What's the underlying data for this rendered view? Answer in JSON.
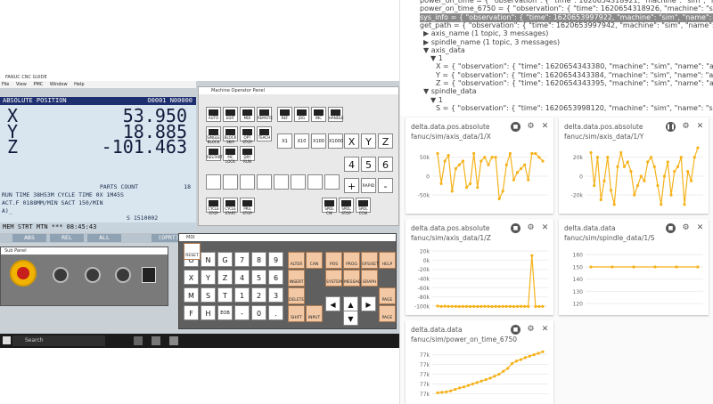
{
  "cnc": {
    "window_title": "FANUC CNC GUIDE",
    "menu": [
      "File",
      "View",
      "PMC",
      "Window",
      "Help"
    ],
    "screen_header": "ABSOLUTE POSITION",
    "program_no": "O0001 N00000",
    "axes": [
      {
        "label": "X",
        "value": "53.950"
      },
      {
        "label": "Y",
        "value": "18.885"
      },
      {
        "label": "Z",
        "value": "-101.463"
      }
    ],
    "parts_count_label": "PARTS COUNT",
    "parts_count": "18",
    "run_time": "RUN TIME     38H53M CYCLE TIME    0X 1M45S",
    "act_f": "ACT.F     0188MM/MIN SACT      150/MIN",
    "prompt": "A)_",
    "s_value": "S 1510002",
    "status": "MEM  STRT MTN ***    08:45:43",
    "softkeys": [
      "ABS",
      "REL",
      "ALL",
      "(OPRT)"
    ],
    "operator_panel_title": "Sub Panel",
    "machine_panel_title": "Machine Operator Panel",
    "mdi_title": "MDI"
  },
  "machine_keys": [
    "AUTO",
    "EDIT",
    "MDI",
    "REMOTE",
    "REF",
    "JOG",
    "INC",
    "HANDLE",
    "SINGLE BLOCK",
    "BLOCK SKIP",
    "OPT STOP",
    "TEACH",
    "RESTART",
    "MC LOCK",
    "DRY RUN",
    "CYCLE STOP",
    "CYCLE START",
    "PRG STOP",
    "SPDL CW",
    "SPDL STOP",
    "SPDL CCW"
  ],
  "jog_keys": [
    "X1",
    "X10",
    "X100",
    "X1000"
  ],
  "axis_keys": [
    "X",
    "Y",
    "Z",
    "4",
    "5",
    "6",
    "+",
    "RAPID",
    "-"
  ],
  "mdi_keys": [
    "O",
    "N",
    "G",
    "7",
    "8",
    "9",
    "X",
    "Y",
    "Z",
    "4",
    "5",
    "6",
    "M",
    "S",
    "T",
    "1",
    "2",
    "3",
    "F",
    "H",
    "EOB",
    "-",
    "0",
    "."
  ],
  "mdi_func_keys": [
    "ALTER",
    "CAN",
    "POS",
    "PROG",
    "OFS/SET",
    "HELP",
    "INSERT",
    "INPUT",
    "SYSTEM",
    "MESSAGE",
    "GRAPH",
    "DELETE",
    "SHIFT",
    "RESET",
    "PAGE",
    "PAGE"
  ],
  "taskbar": {
    "search_placeholder": "Search"
  },
  "tree": {
    "lines": [
      "power_on_time = { \"observation\": { \"time\": 1620654318921, \"machine\": \"sim\", \"name\": \"power_on",
      "power_on_time_6750 = { \"observation\": { \"time\": 1620654318926, \"machine\": \"sim\", \"name\": \"power",
      "sys_info = { \"observation\": { \"time\": 1620653997922, \"machine\": \"sim\", \"name\": \"sys_info\", \"marker\":",
      "get_path = { \"observation\": { \"time\": 1620653997942, \"machine\": \"sim\", \"name\": \"get_path\", \"marker\": {",
      "▶ axis_name (1 topic, 3 messages)",
      "▶ spindle_name (1 topic, 3 messages)",
      "▼ axis_data",
      "▼ 1",
      "X = { \"observation\": { \"time\": 1620654343380, \"machine\": \"sim\", \"name\": \"axis_data\", \"marker\": [{",
      "Y = { \"observation\": { \"time\": 1620654343384, \"machine\": \"sim\", \"name\": \"axis_data\", \"marker\": [{",
      "Z = { \"observation\": { \"time\": 1620654343395, \"machine\": \"sim\", \"name\": \"axis_data\", \"marker\": [{",
      "▼ spindle_data",
      "▼ 1",
      "S = { \"observation\": { \"time\": 1620653998120, \"machine\": \"sim\", \"name\": \"spindle_data\", \"marker\": [{"
    ]
  },
  "cards": [
    {
      "title": "delta.data.pos.absolute",
      "topic": "fanuc/sim/axis_data/1/X"
    },
    {
      "title": "delta.data.pos.absolute",
      "topic": "fanuc/sim/axis_data/1/Y"
    },
    {
      "title": "delta.data.pos.absolute",
      "topic": "fanuc/sim/axis_data/1/Z"
    },
    {
      "title": "delta.data.data",
      "topic": "fanuc/sim/spindle_data/1/S"
    },
    {
      "title": "delta.data.data",
      "topic": "fanuc/sim/power_on_time_6750"
    }
  ],
  "colors": {
    "series": "#f5b21a",
    "accent": "#1d2f6e"
  },
  "chart_data": [
    {
      "type": "line",
      "ylabels": [
        "50k",
        "0",
        "-50k"
      ],
      "yticks": [
        50000,
        0,
        -50000
      ],
      "ylim": [
        -85000,
        80000
      ],
      "values": [
        60000,
        -20000,
        40000,
        55000,
        -40000,
        20000,
        30000,
        40000,
        -30000,
        -20000,
        60000,
        -30000,
        40000,
        50000,
        30000,
        50000,
        50000,
        -60000,
        -40000,
        30000,
        60000,
        -10000,
        10000,
        20000,
        30000,
        -10000,
        60000,
        60000,
        50000,
        40000
      ]
    },
    {
      "type": "line",
      "ylabels": [
        "20k",
        "0",
        "-20k"
      ],
      "yticks": [
        20000,
        0,
        -20000
      ],
      "ylim": [
        -34000,
        32000
      ],
      "values": [
        25000,
        -10000,
        20000,
        -25000,
        -5000,
        20000,
        -15000,
        -30000,
        10000,
        25000,
        10000,
        15000,
        5000,
        -20000,
        -10000,
        0,
        -5000,
        15000,
        20000,
        10000,
        -10000,
        -30000,
        0,
        15000,
        -20000,
        5000,
        10000,
        20000,
        -30000,
        5000,
        -5000,
        20000,
        30000
      ]
    },
    {
      "type": "line",
      "ylabels": [
        "20k",
        "0k",
        "-20k",
        "-40k",
        "-60k",
        "-80k",
        "-100k"
      ],
      "yticks": [
        20000,
        0,
        -20000,
        -40000,
        -60000,
        -80000,
        -100000
      ],
      "ylim": [
        -108000,
        28000
      ],
      "values": [
        -100000,
        -101000,
        -100500,
        -101000,
        -100800,
        -101000,
        -101200,
        -100900,
        -101000,
        -101100,
        -101000,
        -101200,
        -101000,
        -100800,
        -101000,
        -101300,
        -101000,
        -101100,
        -100900,
        -101000,
        -101000,
        -101200,
        -101000,
        -100700,
        -101000,
        -101100,
        10000,
        -101000,
        -101200,
        -101000
      ]
    },
    {
      "type": "line",
      "ylabels": [
        "160",
        "150",
        "140",
        "130",
        "120"
      ],
      "yticks": [
        160,
        150,
        140,
        130,
        120
      ],
      "ylim": [
        115,
        166
      ],
      "values": [
        150,
        150,
        150,
        150,
        150,
        150
      ]
    },
    {
      "type": "line",
      "ylabels": [
        "77k",
        "77k",
        "77k",
        "77k",
        "77k"
      ],
      "yticks": [
        4,
        3,
        2,
        1,
        0
      ],
      "ylim": [
        -0.5,
        4.6
      ],
      "values": [
        0.1,
        0.15,
        0.2,
        0.3,
        0.45,
        0.6,
        0.7,
        0.85,
        1.0,
        1.15,
        1.3,
        1.45,
        1.6,
        1.8,
        2.0,
        2.3,
        2.6,
        3.1,
        3.35,
        3.5,
        3.7,
        3.85,
        4.0,
        4.15,
        4.3
      ]
    }
  ]
}
